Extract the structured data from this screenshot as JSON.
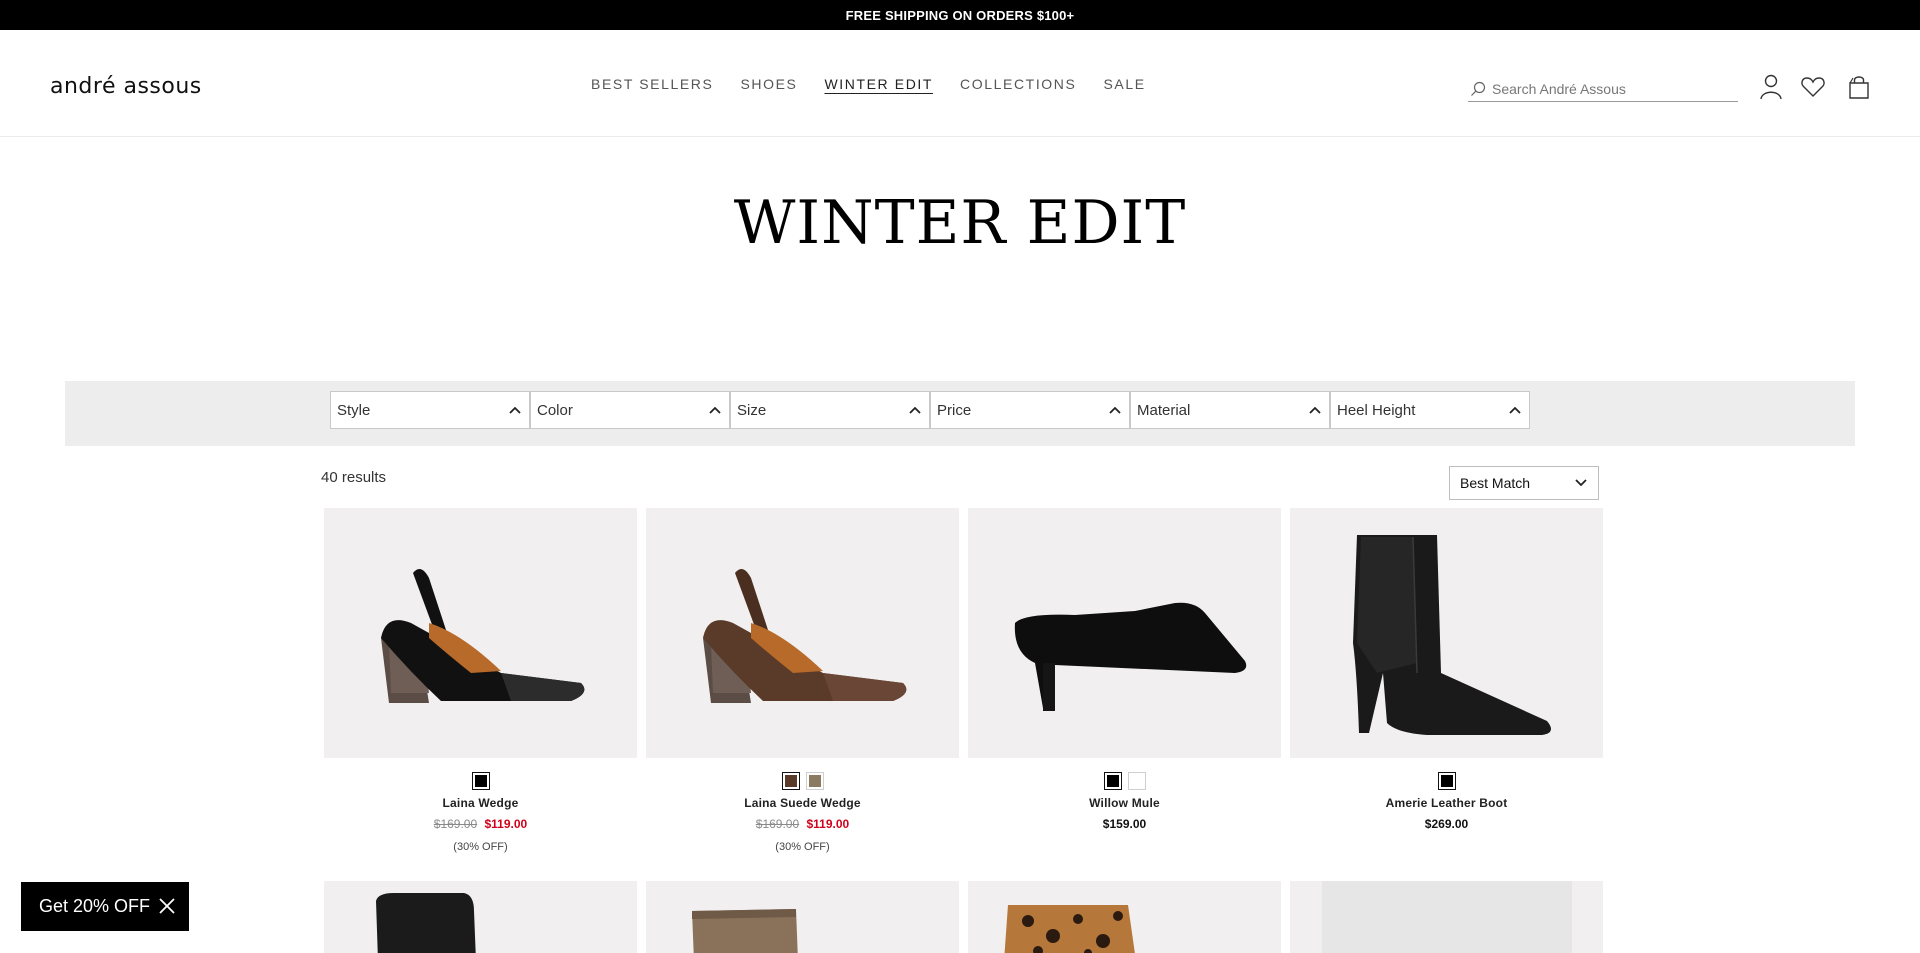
{
  "promo": {
    "text": "FREE SHIPPING ON ORDERS $100+"
  },
  "brand": {
    "logo_text": "andré assous"
  },
  "nav": {
    "items": [
      "BEST SELLERS",
      "SHOES",
      "WINTER EDIT",
      "COLLECTIONS",
      "SALE"
    ],
    "active": "WINTER EDIT"
  },
  "search": {
    "placeholder": "Search André Assous"
  },
  "header_icons": [
    "account-icon",
    "wishlist-heart-icon",
    "shopping-bag-icon"
  ],
  "page": {
    "title": "WINTER EDIT"
  },
  "filters": [
    "Style",
    "Color",
    "Size",
    "Price",
    "Material",
    "Heel Height"
  ],
  "results": {
    "count_text": "40 results"
  },
  "sort": {
    "selected": "Best Match"
  },
  "colors": {
    "sale_red": "#d0021b",
    "image_bg": "#f1efef",
    "filter_band": "#eeeded"
  },
  "products": [
    {
      "name": "Laina Wedge",
      "was": "$169.00",
      "price": "$119.00",
      "discount": "(30% OFF)",
      "swatches": [
        "#000000"
      ],
      "image": "black-slingback-wedge"
    },
    {
      "name": "Laina Suede Wedge",
      "was": "$169.00",
      "price": "$119.00",
      "discount": "(30% OFF)",
      "swatches": [
        "#5a3a28",
        "#8a7a62"
      ],
      "image": "brown-slingback-wedge"
    },
    {
      "name": "Willow Mule",
      "price": "$159.00",
      "swatches": [
        "#000000",
        "#ffffff"
      ],
      "image": "black-suede-mule"
    },
    {
      "name": "Amerie Leather Boot",
      "price": "$269.00",
      "swatches": [
        "#000000"
      ],
      "image": "black-croc-ankle-boot"
    }
  ],
  "row2_images": [
    "black-stretch-boot",
    "taupe-suede-boot",
    "leopard-print-shoe",
    "placeholder-image"
  ],
  "discount_popup": {
    "label": "Get 20% OFF"
  }
}
